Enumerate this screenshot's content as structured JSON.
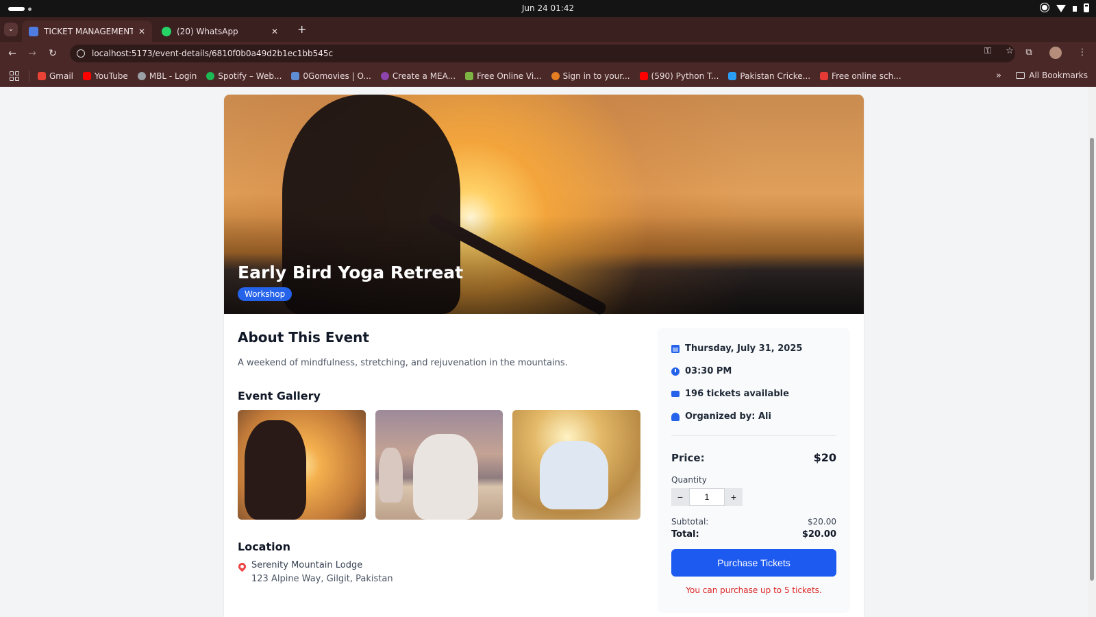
{
  "os": {
    "datetime": "Jun 24  01:42"
  },
  "browser": {
    "tabs": [
      {
        "title": "TICKET MANAGEMENT",
        "active": true
      },
      {
        "title": "(20) WhatsApp",
        "active": false
      }
    ],
    "url": "localhost:5173/event-details/6810f0b0a49d2b1ec1bb545c",
    "bookmarks": [
      {
        "label": "Gmail",
        "color": "#ea4335"
      },
      {
        "label": "YouTube",
        "color": "#ff0000"
      },
      {
        "label": "MBL - Login",
        "color": "#9aa0a6"
      },
      {
        "label": "Spotify – Web...",
        "color": "#1db954"
      },
      {
        "label": "0Gomovies | O...",
        "color": "#5f8dd3"
      },
      {
        "label": "Create a MEA...",
        "color": "#8e44ad"
      },
      {
        "label": "Free Online Vi...",
        "color": "#7cb342"
      },
      {
        "label": "Sign in to your...",
        "color": "#e67e22"
      },
      {
        "label": "(590) Python T...",
        "color": "#ff0000"
      },
      {
        "label": "Pakistan Cricke...",
        "color": "#2a9df4"
      },
      {
        "label": "Free online sch...",
        "color": "#e53935"
      }
    ],
    "bookmarks_more": "»",
    "all_bookmarks": "All Bookmarks"
  },
  "event": {
    "title": "Early Bird Yoga Retreat",
    "category": "Workshop",
    "about_heading": "About This Event",
    "description": "A weekend of mindfulness, stretching, and rejuvenation in the mountains.",
    "gallery_heading": "Event Gallery",
    "location_heading": "Location",
    "location_name": "Serenity Mountain Lodge",
    "location_address": "123 Alpine Way, Gilgit, Pakistan"
  },
  "sidebar": {
    "date": "Thursday, July 31, 2025",
    "time": "03:30 PM",
    "tickets": "196 tickets available",
    "organizer": "Organized by: Ali",
    "price_label": "Price:",
    "price": "$20",
    "quantity_label": "Quantity",
    "quantity": "1",
    "minus": "−",
    "plus": "+",
    "subtotal_label": "Subtotal:",
    "subtotal": "$20.00",
    "total_label": "Total:",
    "total": "$20.00",
    "purchase_label": "Purchase Tickets",
    "limit_note": "You can purchase up to 5 tickets."
  },
  "colors": {
    "accent": "#1d5af0",
    "badge": "#2563eb",
    "warning": "#dc2626"
  }
}
